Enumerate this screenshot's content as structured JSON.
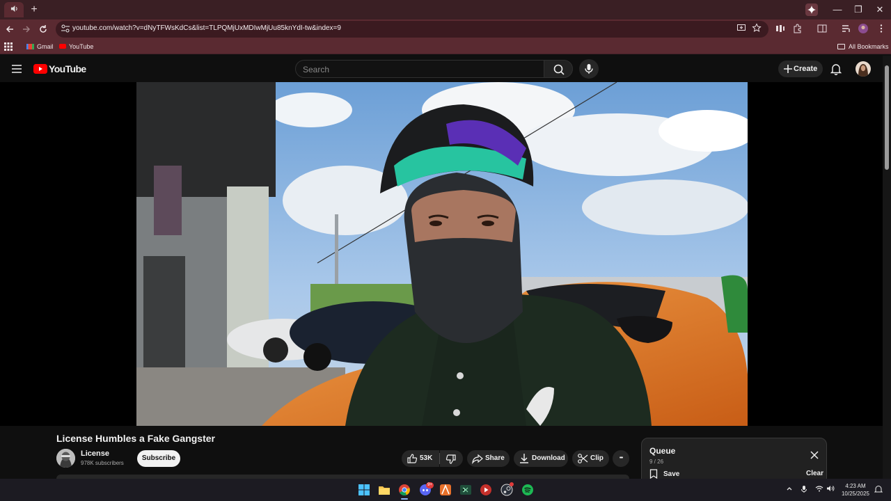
{
  "browser": {
    "tab_icon": "speaker-icon",
    "new_tab": "+",
    "window_controls": {
      "minimize": "—",
      "restore": "❐",
      "close": "✕"
    },
    "url": "youtube.com/watch?v=dNyTFWsKdCs&list=TLPQMjUxMDIwMjUu85knYdI-tw&index=9",
    "bookmarks": {
      "gmail": "Gmail",
      "youtube": "YouTube",
      "all": "All Bookmarks"
    }
  },
  "youtube": {
    "logo_text": "YouTube",
    "search_placeholder": "Search",
    "create_label": "Create"
  },
  "video": {
    "title": "License Humbles a Fake Gangster",
    "channel_name": "License",
    "subscribers": "978K subscribers",
    "subscribe_label": "Subscribe",
    "likes": "53K",
    "share_label": "Share",
    "download_label": "Download",
    "clip_label": "Clip",
    "more_label": "•••"
  },
  "queue": {
    "title": "Queue",
    "position": "9 / 26",
    "save_label": "Save",
    "clear_label": "Clear"
  },
  "taskbar": {
    "time": "4:23 AM",
    "date": "10/25/2025",
    "discord_badge": "9+"
  },
  "colors": {
    "chrome_tabstrip": "#3a1f24",
    "chrome_toolbar": "#5a2a31",
    "yt_red": "#ff0000",
    "yt_background": "#0f0f0f"
  }
}
